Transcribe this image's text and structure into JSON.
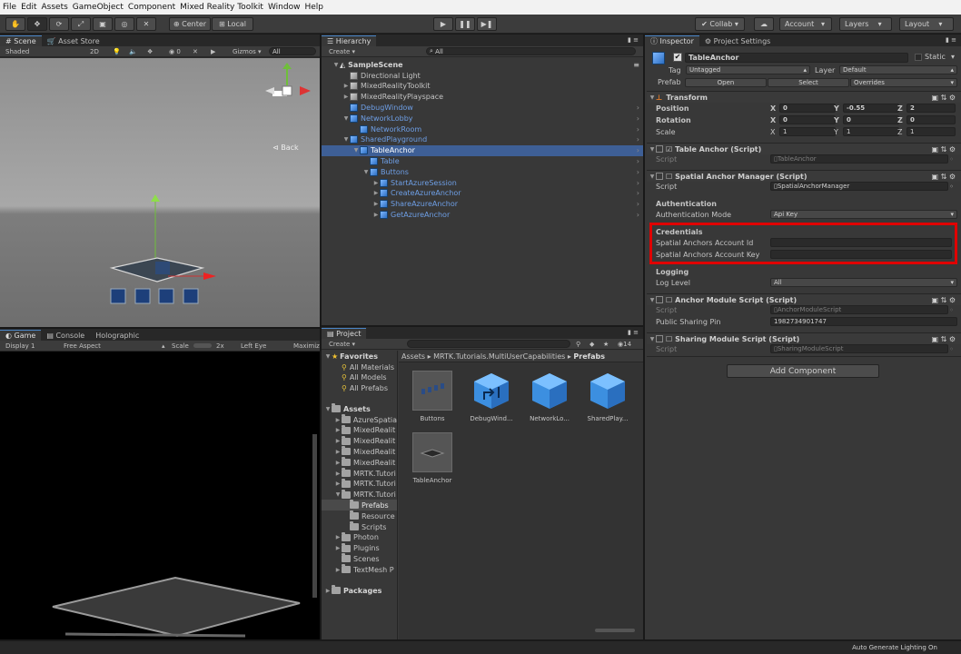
{
  "menubar": [
    "File",
    "Edit",
    "Assets",
    "GameObject",
    "Component",
    "Mixed Reality Toolkit",
    "Window",
    "Help"
  ],
  "toolbar": {
    "center_label": "Center",
    "local_label": "Local",
    "collab_label": "Collab",
    "account_label": "Account",
    "layers_label": "Layers",
    "layout_label": "Layout"
  },
  "scene": {
    "tabs": [
      "Scene",
      "Asset Store"
    ],
    "shading": "Shaded",
    "mode_2d": "2D",
    "fx_count": "0",
    "gizmos": "Gizmos",
    "search_placeholder": "All",
    "back_label": "Back"
  },
  "game": {
    "tabs": [
      "Game",
      "Console",
      "Holographic"
    ],
    "display": "Display 1",
    "aspect": "Free Aspect",
    "scale_label": "Scale",
    "scale_value": "2x",
    "eye": "Left Eye",
    "maximize": "Maximiz"
  },
  "hierarchy": {
    "tab": "Hierarchy",
    "create": "Create",
    "search_placeholder": "All",
    "scene_name": "SampleScene",
    "items": [
      {
        "label": "Directional Light",
        "depth": 1,
        "arrow": "",
        "blue": false
      },
      {
        "label": "MixedRealityToolkit",
        "depth": 1,
        "arrow": "▶",
        "blue": false
      },
      {
        "label": "MixedRealityPlayspace",
        "depth": 1,
        "arrow": "▶",
        "blue": false
      },
      {
        "label": "DebugWindow",
        "depth": 1,
        "arrow": "",
        "blue": true
      },
      {
        "label": "NetworkLobby",
        "depth": 1,
        "arrow": "▼",
        "blue": true
      },
      {
        "label": "NetworkRoom",
        "depth": 2,
        "arrow": "",
        "blue": true
      },
      {
        "label": "SharedPlayground",
        "depth": 1,
        "arrow": "▼",
        "blue": true
      },
      {
        "label": "TableAnchor",
        "depth": 2,
        "arrow": "▼",
        "blue": true,
        "selected": true
      },
      {
        "label": "Table",
        "depth": 3,
        "arrow": "",
        "blue": true
      },
      {
        "label": "Buttons",
        "depth": 3,
        "arrow": "▼",
        "blue": true
      },
      {
        "label": "StartAzureSession",
        "depth": 4,
        "arrow": "▶",
        "blue": true
      },
      {
        "label": "CreateAzureAnchor",
        "depth": 4,
        "arrow": "▶",
        "blue": true
      },
      {
        "label": "ShareAzureAnchor",
        "depth": 4,
        "arrow": "▶",
        "blue": true
      },
      {
        "label": "GetAzureAnchor",
        "depth": 4,
        "arrow": "▶",
        "blue": true
      }
    ]
  },
  "project": {
    "tab": "Project",
    "create": "Create",
    "count": "14",
    "favorites_label": "Favorites",
    "favorites": [
      "All Materials",
      "All Models",
      "All Prefabs"
    ],
    "assets_label": "Assets",
    "folders": [
      {
        "label": "AzureSpatia",
        "depth": 1,
        "arrow": "▶"
      },
      {
        "label": "MixedRealit",
        "depth": 1,
        "arrow": "▶"
      },
      {
        "label": "MixedRealit",
        "depth": 1,
        "arrow": "▶"
      },
      {
        "label": "MixedRealit",
        "depth": 1,
        "arrow": "▶"
      },
      {
        "label": "MixedRealit",
        "depth": 1,
        "arrow": "▶"
      },
      {
        "label": "MRTK.Tutori",
        "depth": 1,
        "arrow": "▶"
      },
      {
        "label": "MRTK.Tutori",
        "depth": 1,
        "arrow": "▶"
      },
      {
        "label": "MRTK.Tutori",
        "depth": 1,
        "arrow": "▼"
      },
      {
        "label": "Prefabs",
        "depth": 2,
        "arrow": "",
        "selected": true
      },
      {
        "label": "Resource",
        "depth": 2,
        "arrow": ""
      },
      {
        "label": "Scripts",
        "depth": 2,
        "arrow": ""
      },
      {
        "label": "Photon",
        "depth": 1,
        "arrow": "▶"
      },
      {
        "label": "Plugins",
        "depth": 1,
        "arrow": "▶"
      },
      {
        "label": "Scenes",
        "depth": 1,
        "arrow": ""
      },
      {
        "label": "TextMesh P",
        "depth": 1,
        "arrow": "▶"
      }
    ],
    "packages_label": "Packages",
    "breadcrumb": [
      "Assets",
      "MRTK.Tutorials.MultiUserCapabilities",
      "Prefabs"
    ],
    "assets": [
      {
        "label": "Buttons",
        "kind": "gray"
      },
      {
        "label": "DebugWind...",
        "kind": "blue-arrow"
      },
      {
        "label": "NetworkLo...",
        "kind": "blue"
      },
      {
        "label": "SharedPlay...",
        "kind": "blue"
      },
      {
        "label": "TableAnchor",
        "kind": "gray-flat"
      }
    ]
  },
  "inspector": {
    "tabs": [
      "Inspector",
      "Project Settings"
    ],
    "object_name": "TableAnchor",
    "static_label": "Static",
    "tag_label": "Tag",
    "tag_value": "Untagged",
    "layer_label": "Layer",
    "layer_value": "Default",
    "prefab_label": "Prefab",
    "prefab_open": "Open",
    "prefab_select": "Select",
    "prefab_overrides": "Overrides",
    "transform": {
      "title": "Transform",
      "position_label": "Position",
      "position": [
        "0",
        "-0.55",
        "2"
      ],
      "rotation_label": "Rotation",
      "rotation": [
        "0",
        "0",
        "0"
      ],
      "scale_label": "Scale",
      "scale": [
        "1",
        "1",
        "1"
      ]
    },
    "table_anchor": {
      "title": "Table Anchor (Script)",
      "script_label": "Script",
      "script_value": "TableAnchor"
    },
    "spatial_anchor_manager": {
      "title": "Spatial Anchor Manager (Script)",
      "script_label": "Script",
      "script_value": "SpatialAnchorManager",
      "authentication_header": "Authentication",
      "auth_mode_label": "Authentication Mode",
      "auth_mode_value": "Api Key",
      "credentials_header": "Credentials",
      "account_id_label": "Spatial Anchors Account Id",
      "account_id_value": "",
      "account_key_label": "Spatial Anchors Account Key",
      "account_key_value": "",
      "logging_header": "Logging",
      "log_level_label": "Log Level",
      "log_level_value": "All"
    },
    "anchor_module": {
      "title": "Anchor Module Script (Script)",
      "script_label": "Script",
      "script_value": "AnchorModuleScript",
      "pin_label": "Public Sharing Pin",
      "pin_value": "1982734901747"
    },
    "sharing_module": {
      "title": "Sharing Module Script (Script)",
      "script_label": "Script",
      "script_value": "SharingModuleScript"
    },
    "add_component": "Add Component",
    "highlight_color": "#e00000"
  },
  "status": {
    "text": "Auto Generate Lighting On"
  }
}
